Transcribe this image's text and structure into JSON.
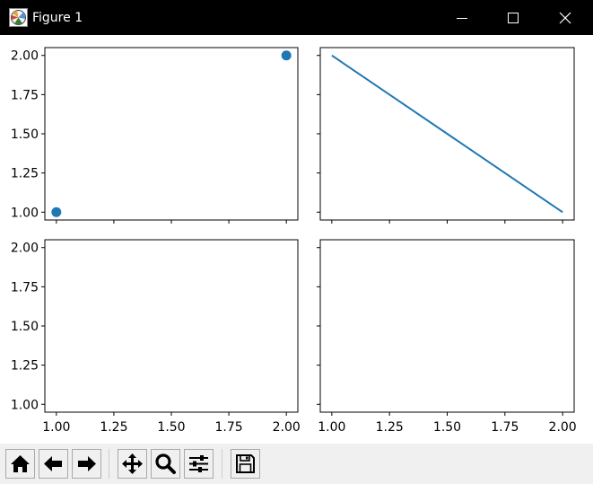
{
  "window": {
    "title": "Figure 1",
    "icons": {
      "app": "matplotlib-logo-icon",
      "minimize": "minimize-icon",
      "maximize": "maximize-icon",
      "close": "close-icon"
    }
  },
  "toolbar": {
    "buttons": [
      {
        "icon": "home-icon"
      },
      {
        "icon": "arrow-left-icon"
      },
      {
        "icon": "arrow-right-icon"
      },
      {
        "icon": "move-arrows-icon"
      },
      {
        "icon": "zoom-magnifier-icon"
      },
      {
        "icon": "sliders-icon"
      },
      {
        "icon": "save-floppy-icon"
      }
    ]
  },
  "colors": {
    "series": "#1f77b4",
    "titlebar": "#000000",
    "toolbar": "#f0f0f0"
  },
  "chart_data": [
    {
      "type": "scatter",
      "position": "top-left",
      "x": [
        1.0,
        2.0
      ],
      "y": [
        1.0,
        2.0
      ],
      "xlim": [
        0.95,
        2.05
      ],
      "ylim": [
        0.95,
        2.05
      ],
      "yticks": [
        "1.00",
        "1.25",
        "1.50",
        "1.75",
        "2.00"
      ],
      "xtick_labels_visible": false,
      "ytick_labels_visible": true
    },
    {
      "type": "line",
      "position": "top-right",
      "x": [
        1.0,
        2.0
      ],
      "y": [
        2.0,
        1.0
      ],
      "xlim": [
        0.95,
        2.05
      ],
      "ylim": [
        0.95,
        2.05
      ],
      "xtick_labels_visible": false,
      "ytick_labels_visible": false
    },
    {
      "type": "scatter",
      "position": "bottom-left",
      "x": [],
      "y": [],
      "xlim": [
        0.95,
        2.05
      ],
      "ylim": [
        0.95,
        2.05
      ],
      "xticks": [
        "1.00",
        "1.25",
        "1.50",
        "1.75",
        "2.00"
      ],
      "yticks": [
        "1.00",
        "1.25",
        "1.50",
        "1.75",
        "2.00"
      ],
      "xtick_labels_visible": true,
      "ytick_labels_visible": true
    },
    {
      "type": "scatter",
      "position": "bottom-right",
      "x": [],
      "y": [],
      "xlim": [
        0.95,
        2.05
      ],
      "ylim": [
        0.95,
        2.05
      ],
      "xticks": [
        "1.00",
        "1.25",
        "1.50",
        "1.75",
        "2.00"
      ],
      "xtick_labels_visible": true,
      "ytick_labels_visible": false
    }
  ]
}
